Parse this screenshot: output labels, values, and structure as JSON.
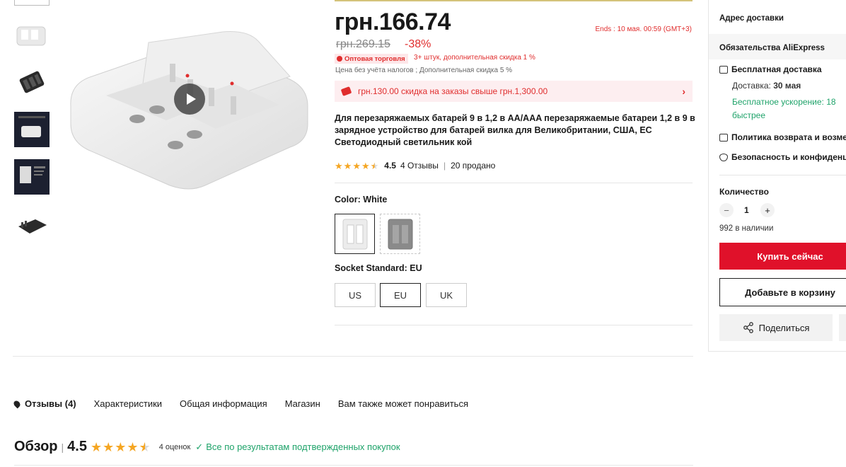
{
  "product": {
    "price": "грн.166.74",
    "old_price": "грн.269.15",
    "discount_pct": "-38%",
    "ends_label": "Ends :  10 мая. 00:59 (GMT+3)",
    "wholesale_badge": "Оптовая торговля",
    "wholesale_text": "3+ штук, дополнительная скидка 1 %",
    "tax_note": "Цена без учёта налогов ; Дополнительная скидка 5 %",
    "coupon_text": "грн.130.00 скидка на заказы свыше грн.1,300.00",
    "coupon_chevron": "›",
    "title": "Для перезаряжаемых батарей 9 в 1,2 в AA/AAA перезаряжаемые батареи 1,2 в 9 в зарядное устройство для батарей вилка для Великобритании, США, ЕС Светодиодный светильник кой",
    "rating": "4.5",
    "reviews": "4 Отзывы",
    "sold": "20 продано",
    "color_label": "Color:",
    "color_value": "White",
    "socket_label": "Socket Standard:",
    "socket_value": "EU",
    "socket_options": [
      "US",
      "EU",
      "UK"
    ]
  },
  "right_panel": {
    "address": "Адрес доставки",
    "commitments": "Обязательства AliExpress",
    "free_shipping": "Бесплатная доставка",
    "delivery_prefix": "Доставка:",
    "delivery_date": "30 мая",
    "fast_line1": "Бесплатное ускорение: 18",
    "fast_line2": "быстрее",
    "return_policy": "Политика возврата и возме",
    "security": "Безопасность и конфиденц",
    "quantity_label": "Количество",
    "quantity": "1",
    "minus": "−",
    "plus": "+",
    "stock": "992 в наличии",
    "buy_now": "Купить сейчас",
    "add_to_cart": "Добавьте в корзину",
    "share": "Поделиться"
  },
  "tabs": [
    "Отзывы (4)",
    "Характеристики",
    "Общая информация",
    "Магазин",
    "Вам также может понравиться"
  ],
  "review_summary": {
    "title": "Обзор",
    "bar": "|",
    "score": "4.5",
    "count": "4 оценок",
    "verified": "Все по результатам подтвержденных покупок"
  },
  "colors": {
    "accent_red": "#e02d2d",
    "buy_red": "#e0112a",
    "star": "#f5a623",
    "green": "#1fa36a"
  }
}
